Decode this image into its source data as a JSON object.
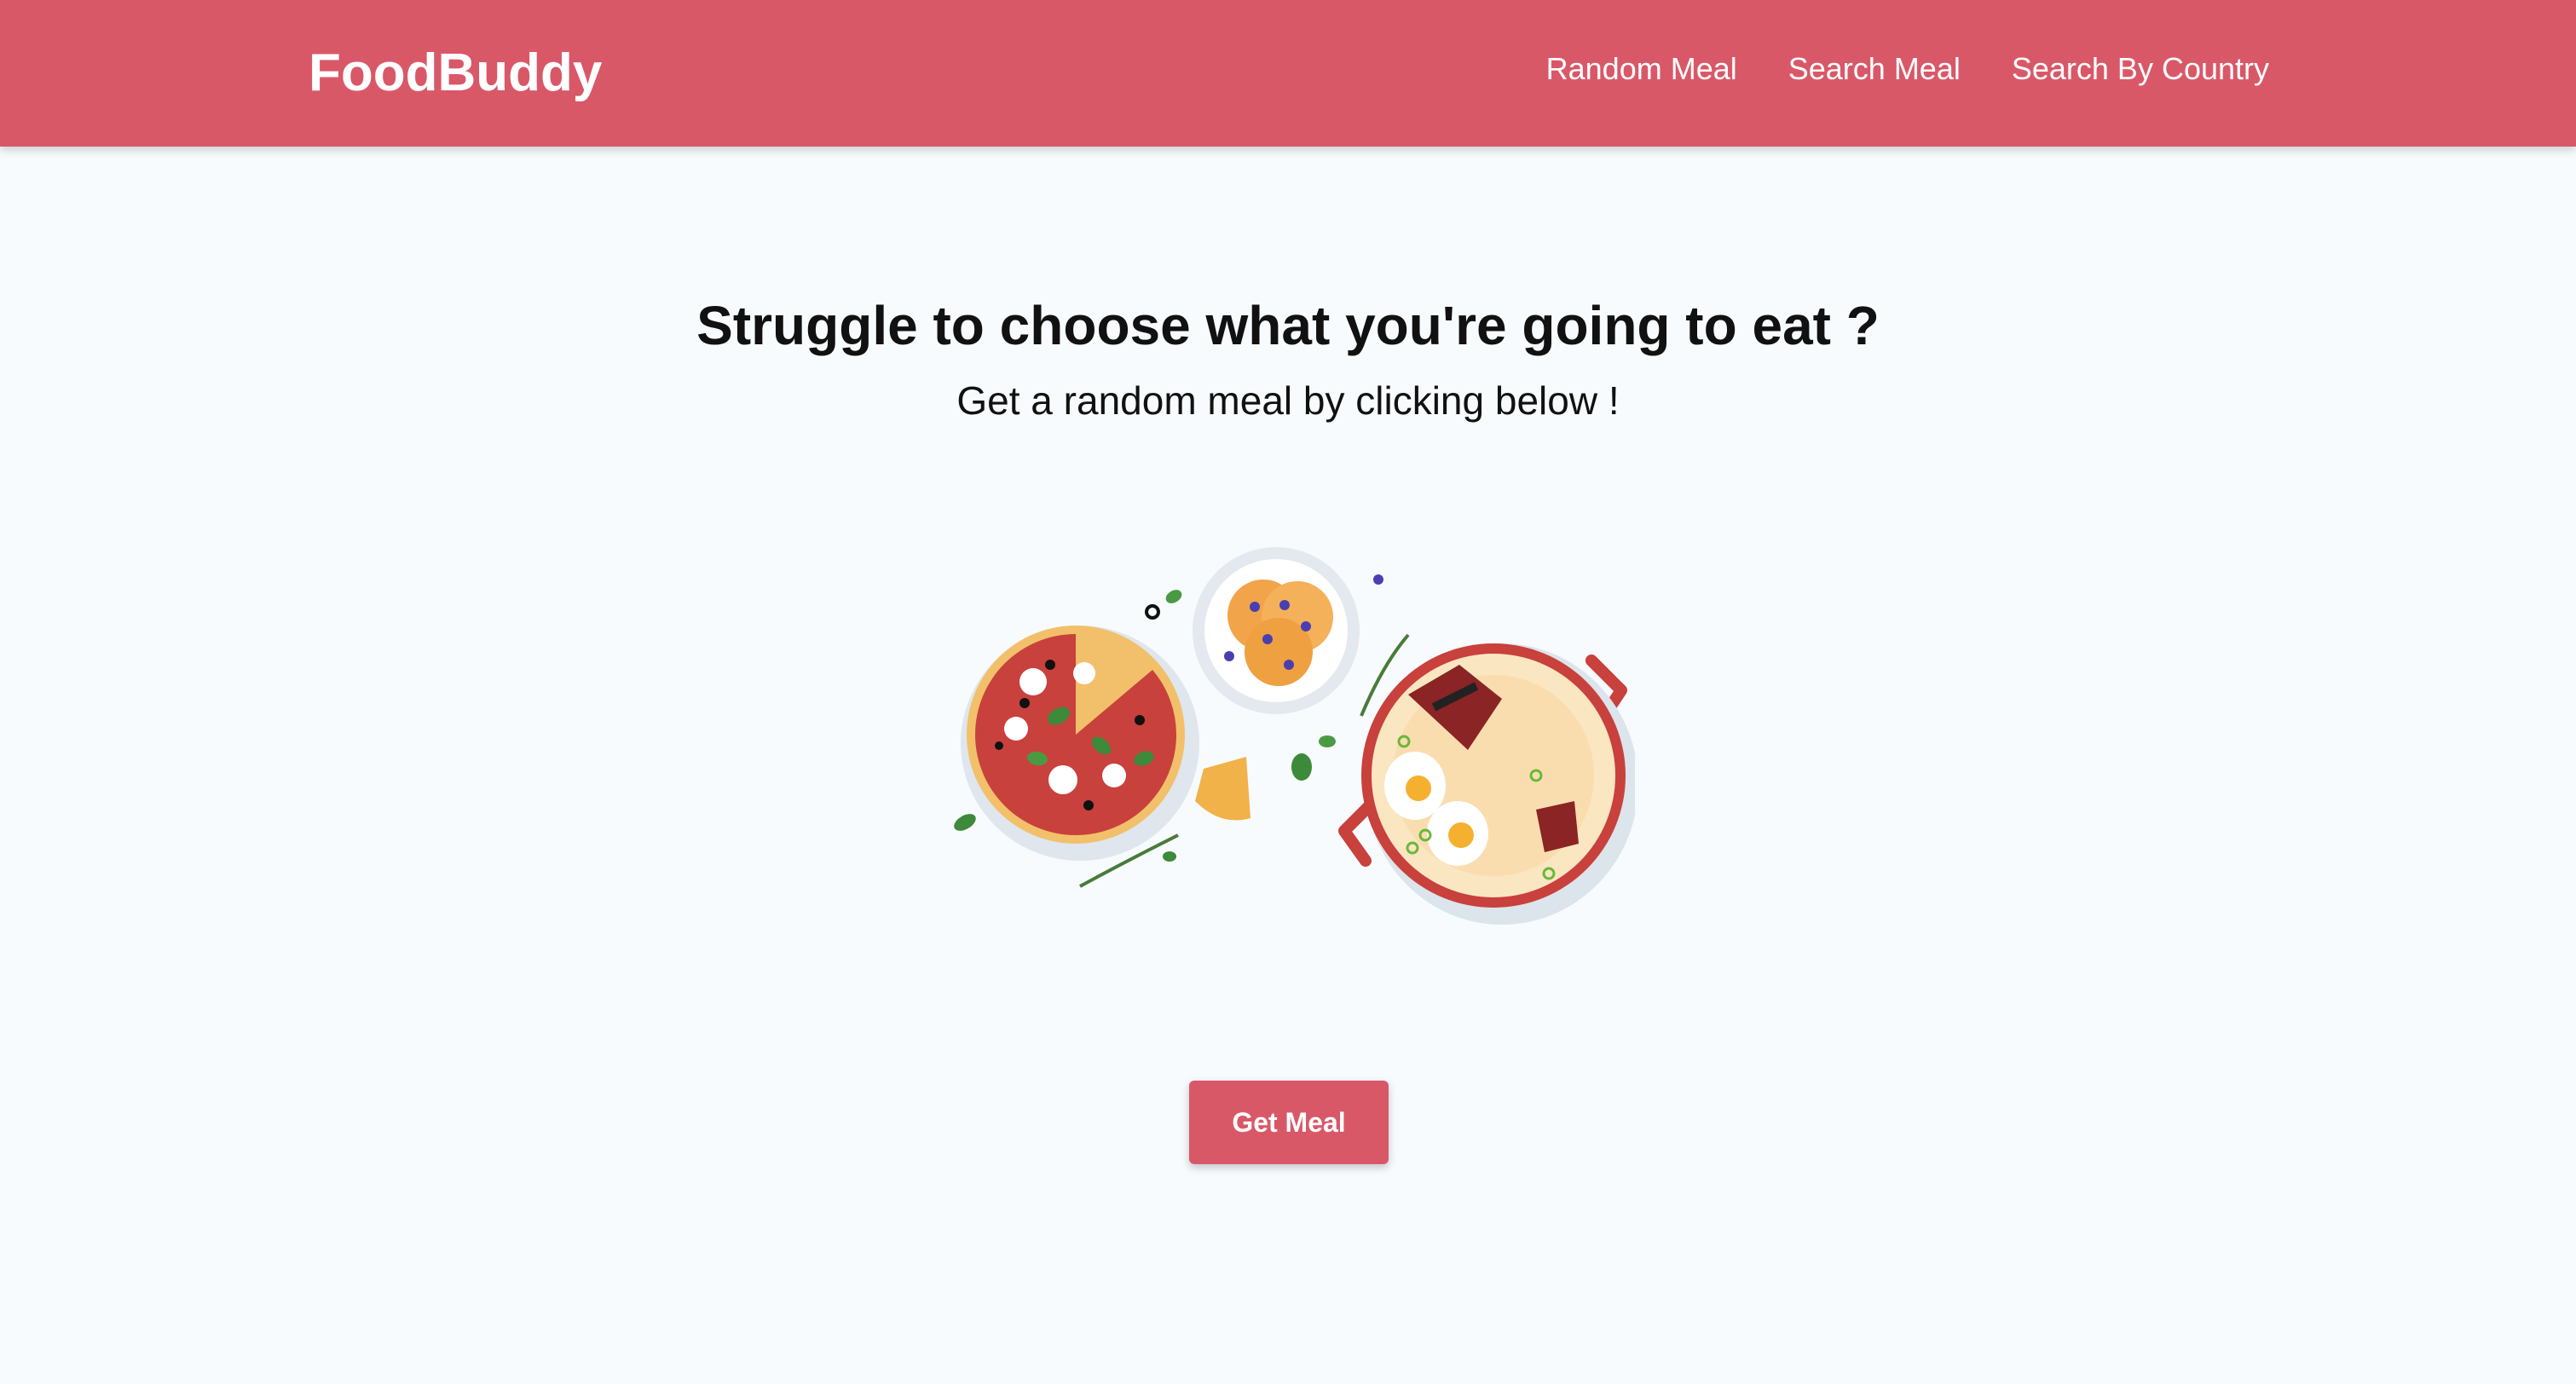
{
  "header": {
    "brand": "FoodBuddy",
    "nav": [
      "Random Meal",
      "Search Meal",
      "Search By Country"
    ]
  },
  "main": {
    "headline": "Struggle to choose what you're going to eat ?",
    "subline": "Get a random meal by clicking below !",
    "illustration": "food-illustration",
    "button_label": "Get Meal"
  },
  "colors": {
    "brand": "#d95868",
    "background": "#f8fbfe",
    "text": "#111111"
  }
}
